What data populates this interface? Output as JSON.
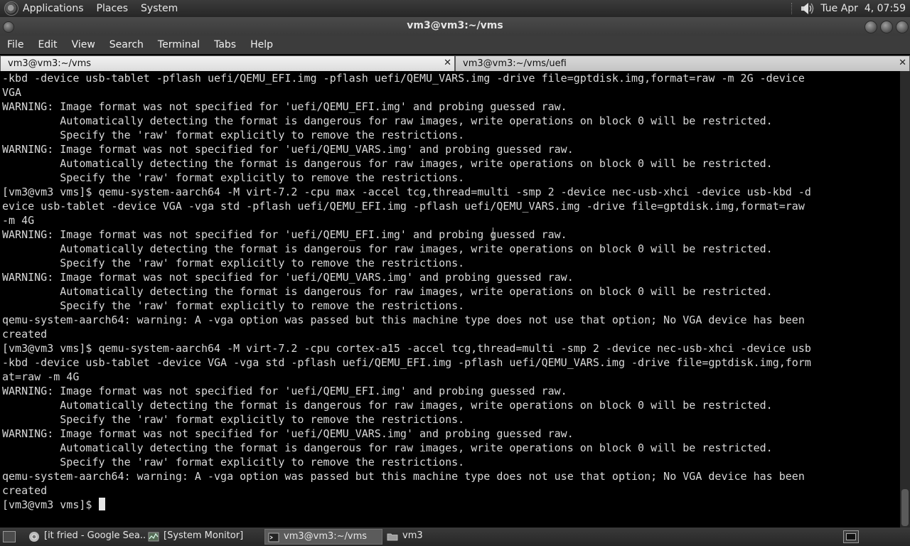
{
  "top_panel": {
    "menus": [
      "Applications",
      "Places",
      "System"
    ],
    "clock": "Tue Apr  4, 07:59",
    "icons": [
      "distro-logo-icon",
      "speaker-icon"
    ]
  },
  "window": {
    "title": "vm3@vm3:~/vms"
  },
  "menubar": [
    "File",
    "Edit",
    "View",
    "Search",
    "Terminal",
    "Tabs",
    "Help"
  ],
  "tabs": [
    {
      "label": "vm3@vm3:~/vms",
      "active": true
    },
    {
      "label": "vm3@vm3:~/vms/uefi",
      "active": false
    }
  ],
  "terminal": {
    "lines": [
      "-kbd -device usb-tablet -pflash uefi/QEMU_EFI.img -pflash uefi/QEMU_VARS.img -drive file=gptdisk.img,format=raw -m 2G -device",
      "VGA",
      "WARNING: Image format was not specified for 'uefi/QEMU_EFI.img' and probing guessed raw.",
      "         Automatically detecting the format is dangerous for raw images, write operations on block 0 will be restricted.",
      "         Specify the 'raw' format explicitly to remove the restrictions.",
      "WARNING: Image format was not specified for 'uefi/QEMU_VARS.img' and probing guessed raw.",
      "         Automatically detecting the format is dangerous for raw images, write operations on block 0 will be restricted.",
      "         Specify the 'raw' format explicitly to remove the restrictions.",
      "[vm3@vm3 vms]$ qemu-system-aarch64 -M virt-7.2 -cpu max -accel tcg,thread=multi -smp 2 -device nec-usb-xhci -device usb-kbd -d",
      "evice usb-tablet -device VGA -vga std -pflash uefi/QEMU_EFI.img -pflash uefi/QEMU_VARS.img -drive file=gptdisk.img,format=raw",
      "-m 4G",
      "WARNING: Image format was not specified for 'uefi/QEMU_EFI.img' and probing guessed raw.",
      "         Automatically detecting the format is dangerous for raw images, write operations on block 0 will be restricted.",
      "         Specify the 'raw' format explicitly to remove the restrictions.",
      "WARNING: Image format was not specified for 'uefi/QEMU_VARS.img' and probing guessed raw.",
      "         Automatically detecting the format is dangerous for raw images, write operations on block 0 will be restricted.",
      "         Specify the 'raw' format explicitly to remove the restrictions.",
      "qemu-system-aarch64: warning: A -vga option was passed but this machine type does not use that option; No VGA device has been",
      "created",
      "[vm3@vm3 vms]$ qemu-system-aarch64 -M virt-7.2 -cpu cortex-a15 -accel tcg,thread=multi -smp 2 -device nec-usb-xhci -device usb",
      "-kbd -device usb-tablet -device VGA -vga std -pflash uefi/QEMU_EFI.img -pflash uefi/QEMU_VARS.img -drive file=gptdisk.img,form",
      "at=raw -m 4G",
      "WARNING: Image format was not specified for 'uefi/QEMU_EFI.img' and probing guessed raw.",
      "         Automatically detecting the format is dangerous for raw images, write operations on block 0 will be restricted.",
      "         Specify the 'raw' format explicitly to remove the restrictions.",
      "WARNING: Image format was not specified for 'uefi/QEMU_VARS.img' and probing guessed raw.",
      "         Automatically detecting the format is dangerous for raw images, write operations on block 0 will be restricted.",
      "         Specify the 'raw' format explicitly to remove the restrictions.",
      "qemu-system-aarch64: warning: A -vga option was passed but this machine type does not use that option; No VGA device has been",
      "created"
    ],
    "prompt": "[vm3@vm3 vms]$ "
  },
  "taskbar": [
    {
      "label": "[it fried - Google Sea...",
      "icon": "chrome-icon",
      "active": false
    },
    {
      "label": "[System Monitor]",
      "icon": "system-monitor-icon",
      "active": false
    },
    {
      "label": "vm3@vm3:~/vms",
      "icon": "terminal-icon",
      "active": true
    },
    {
      "label": "vm3",
      "icon": "folder-icon",
      "active": false
    }
  ],
  "colors": {
    "terminal_bg": "#000000",
    "terminal_fg": "#d8d8d8",
    "panel_bg": "#2e2e2e"
  }
}
